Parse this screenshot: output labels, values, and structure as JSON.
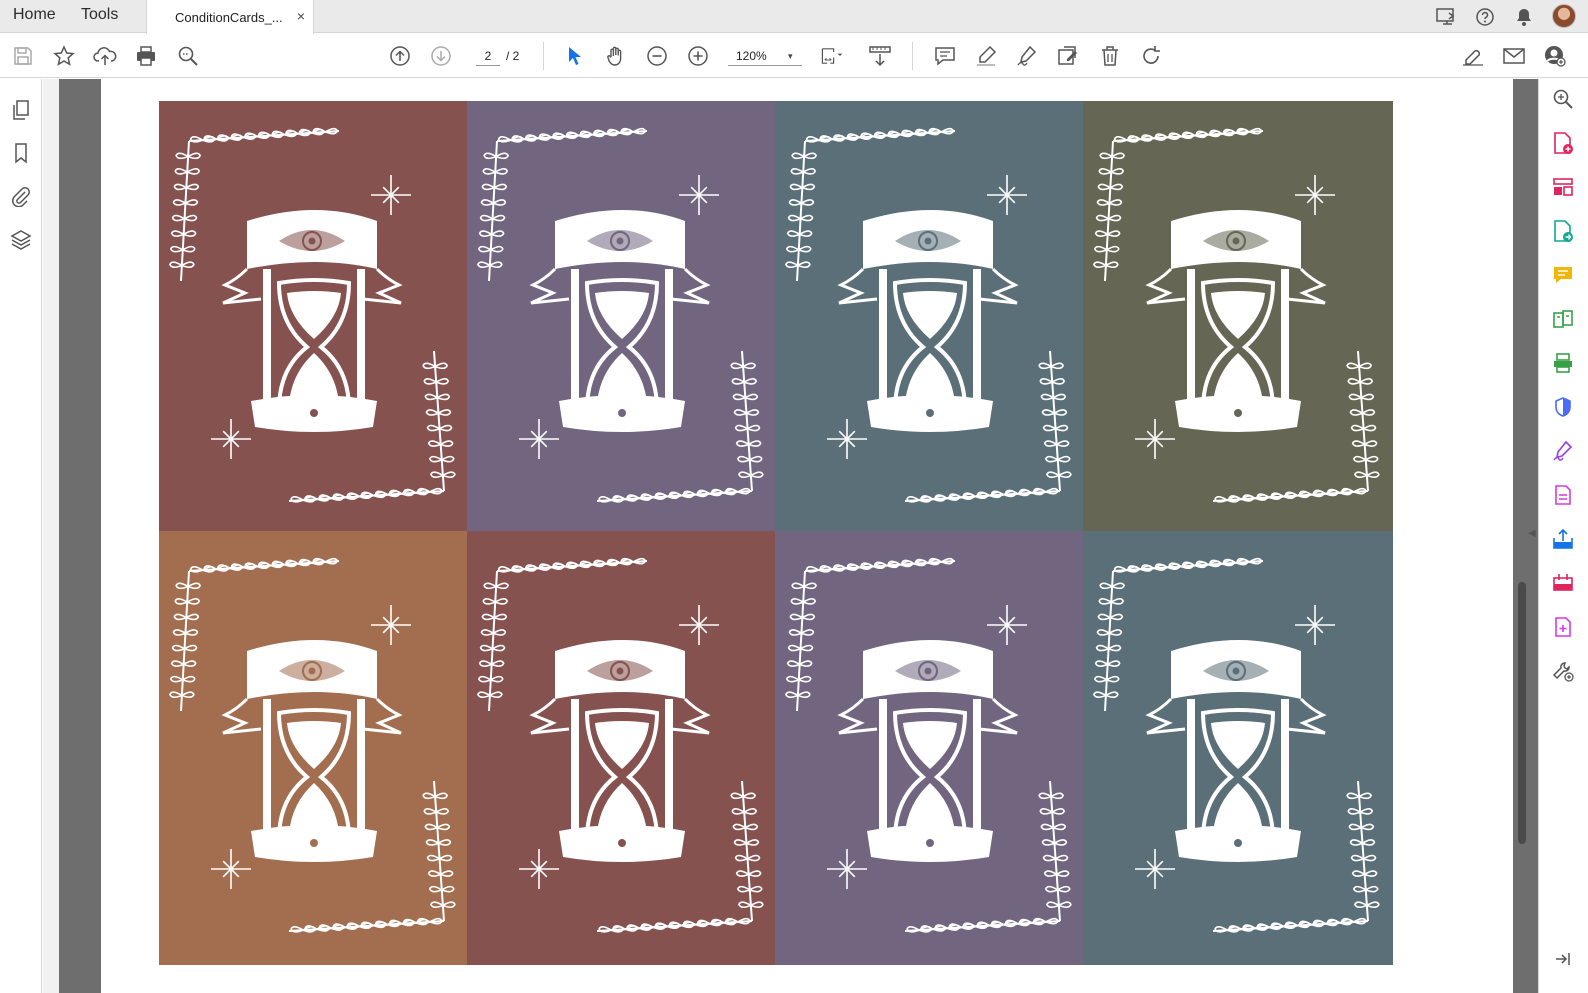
{
  "tabbar": {
    "home_label": "Home",
    "tools_label": "Tools",
    "document_tab_label": "ConditionCards_...",
    "close_glyph": "×"
  },
  "toolbar": {
    "current_page": "2",
    "page_total": "/ 2",
    "zoom": "120%",
    "zoom_caret": "▾"
  },
  "cards": [
    {
      "color": "#85524f"
    },
    {
      "color": "#71657f"
    },
    {
      "color": "#5b6f79"
    },
    {
      "color": "#656754"
    },
    {
      "color": "#a36e4f"
    },
    {
      "color": "#85524f"
    },
    {
      "color": "#71657f"
    },
    {
      "color": "#5b6f79"
    }
  ],
  "icons": {
    "top": [
      "share-screen-icon",
      "help-icon",
      "bell-icon"
    ],
    "toolbar": [
      "save-icon",
      "star-icon",
      "cloud-upload-icon",
      "print-icon",
      "find-icon",
      "page-up-icon",
      "page-down-icon",
      "select-arrow-icon",
      "hand-icon",
      "zoom-out-icon",
      "zoom-in-icon",
      "fit-page-icon",
      "scroll-mode-icon",
      "comment-icon",
      "highlight-icon",
      "sign-icon",
      "edit-pdf-icon",
      "delete-icon",
      "rotate-icon",
      "sign-share-icon",
      "email-icon",
      "account-icon"
    ],
    "left_rail": [
      "pages-icon",
      "bookmark-icon",
      "attachment-icon",
      "layers-icon"
    ],
    "right_panel": [
      "search-tools-icon",
      "create-pdf-icon",
      "organize-pages-icon",
      "export-pdf-icon",
      "comment-tool-icon",
      "compare-icon",
      "scan-icon",
      "protect-icon",
      "fill-sign-icon",
      "edit-pdf-tool-icon",
      "share-icon",
      "combine-icon",
      "more-tools-icon",
      "customize-icon",
      "collapse-panel-icon"
    ]
  },
  "colors": {
    "accent": "#1473e6",
    "viewport": "#6e6e6e",
    "card_line": "#ffffff"
  }
}
